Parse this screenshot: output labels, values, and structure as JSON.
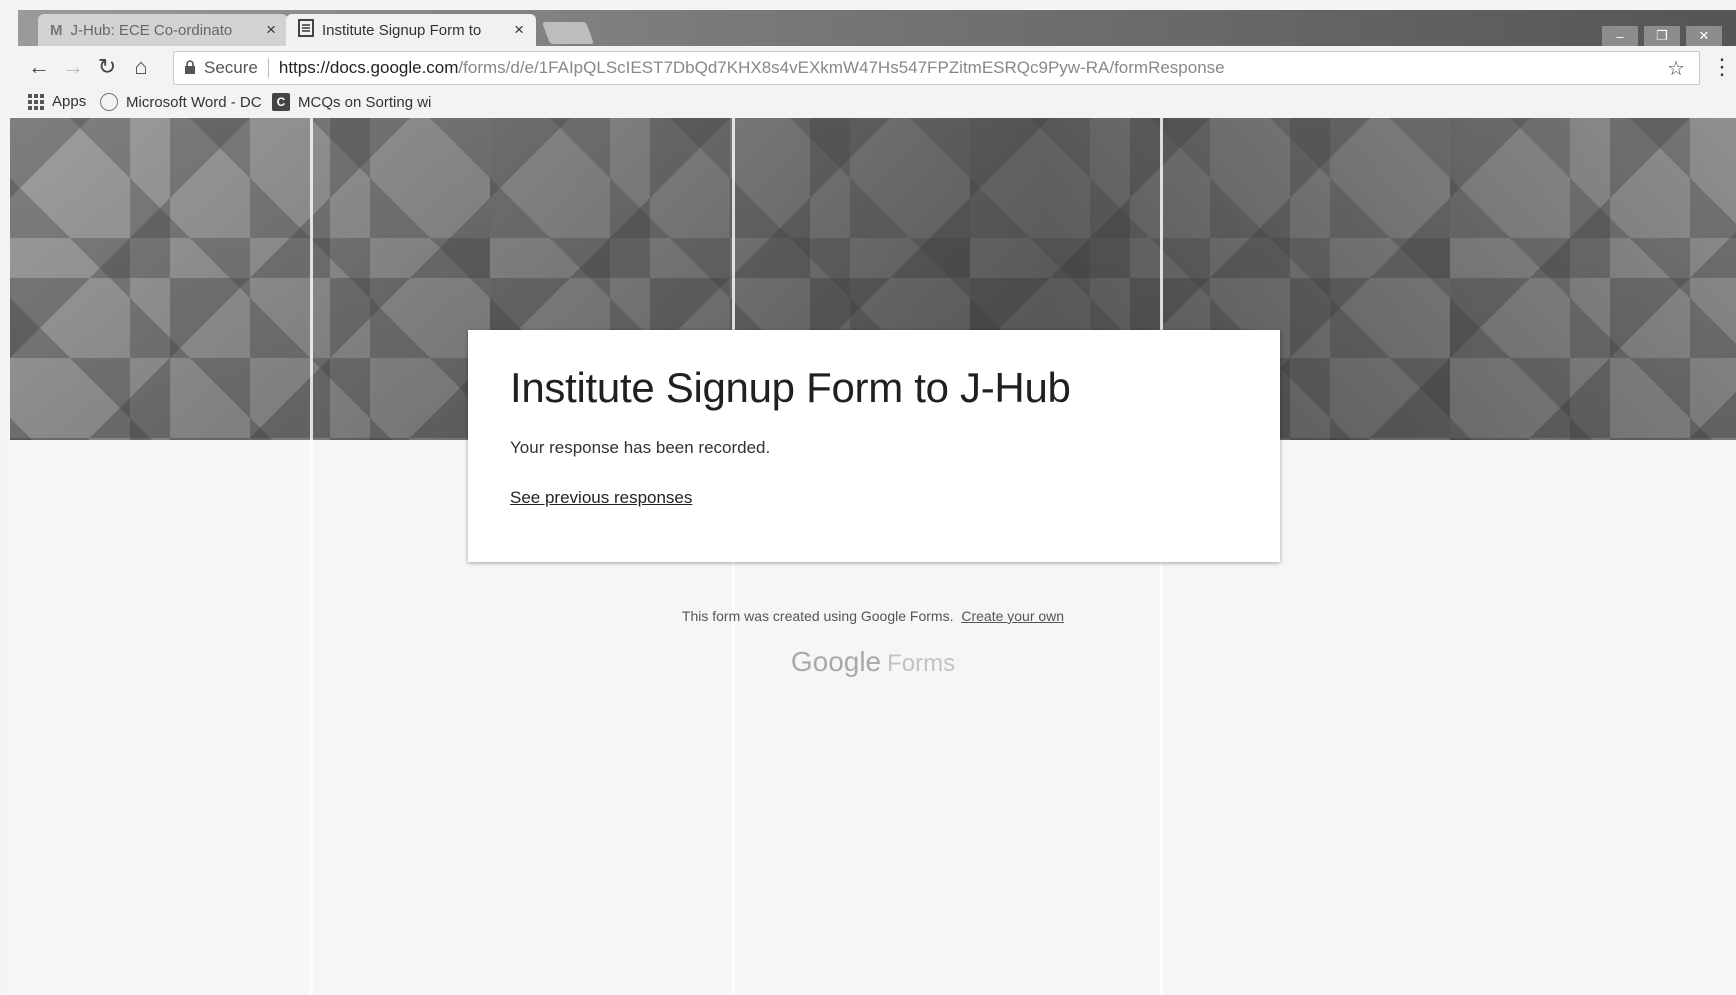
{
  "browser": {
    "tabs": [
      {
        "title": "J-Hub: ECE Co-ordinato",
        "icon": "gmail-icon",
        "active": false
      },
      {
        "title": "Institute Signup Form to",
        "icon": "forms-icon",
        "active": true
      }
    ],
    "tab_close": "×",
    "window_controls": {
      "minimize": "–",
      "restore": "❐",
      "close": "✕"
    },
    "nav": {
      "back": "←",
      "forward": "→",
      "reload": "↻",
      "home": "⌂"
    },
    "address": {
      "secure_label": "Secure",
      "url_main": "https://docs.google.com",
      "url_rest": "/forms/d/e/1FAIpQLScIEST7DbQd7KHX8s4vEXkmW47Hs547FPZitmESRQc9Pyw-RA/formResponse"
    },
    "bookmark_star": "☆",
    "menu": "⋮",
    "bookmarks": [
      {
        "label": "Apps",
        "icon": "apps-grid-icon"
      },
      {
        "label": "Microsoft Word - DC",
        "icon": "site-icon"
      },
      {
        "label": "MCQs on Sorting wi",
        "icon": "c-icon"
      }
    ]
  },
  "form": {
    "title": "Institute Signup Form to J-Hub",
    "confirmation": "Your response has been recorded.",
    "previous_link": "See previous responses"
  },
  "footer": {
    "note": "This form was created using Google Forms.",
    "create_link": "Create your own",
    "brand_google": "Google",
    "brand_forms": "Forms"
  },
  "colors": {
    "banner": "#7d7d7d",
    "card": "#ffffff",
    "page": "#f6f6f6"
  }
}
